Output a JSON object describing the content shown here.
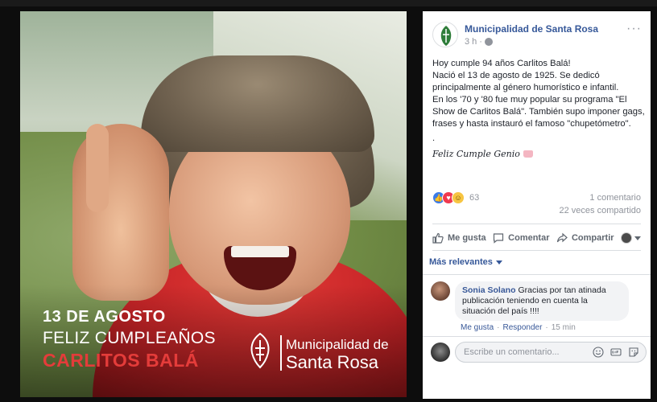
{
  "image": {
    "date": "13 DE AGOSTO",
    "greeting": "FELIZ CUMPLEAÑOS",
    "name": "CARLITOS BALÁ",
    "org_small": "Municipalidad de",
    "org_big": "Santa Rosa"
  },
  "post": {
    "page_name": "Municipalidad de Santa Rosa",
    "time": "3 h",
    "text_lines": [
      "Hoy cumple 94 años Carlitos Balá!",
      "Nació el 13 de agosto de 1925. Se dedicó principalmente al género humorístico e infantil.",
      "En los '70 y '80 fue muy popular su programa \"El Show de Carlitos Balá\". También supo imponer gags, frases y hasta instauró el famoso \"chupetómetro\".",
      "."
    ],
    "signature": "Feliz Cumple Genio",
    "reaction_count": "63",
    "comments_count": "1 comentario",
    "shares_count": "22 veces compartido"
  },
  "actions": {
    "like": "Me gusta",
    "comment": "Comentar",
    "share": "Compartir"
  },
  "comments_filter": "Más relevantes",
  "comment": {
    "author": "Sonia Solano",
    "text": "Gracias por tan atinada publicación teniendo en cuenta la situación del país !!!!",
    "like": "Me gusta",
    "reply": "Responder",
    "time": "15 min"
  },
  "composer": {
    "placeholder": "Escribe un comentario..."
  },
  "colors": {
    "link_blue": "#365899",
    "name_red": "#e43c3a",
    "like_blue": "#3b7be8",
    "love_red": "#f0394f",
    "haha_yellow": "#f7c542"
  },
  "icons": [
    "globe-icon",
    "more-options-icon",
    "like-reaction-icon",
    "love-reaction-icon",
    "haha-reaction-icon",
    "like-icon",
    "comment-icon",
    "share-icon",
    "emoji-icon",
    "gif-icon",
    "sticker-icon"
  ]
}
